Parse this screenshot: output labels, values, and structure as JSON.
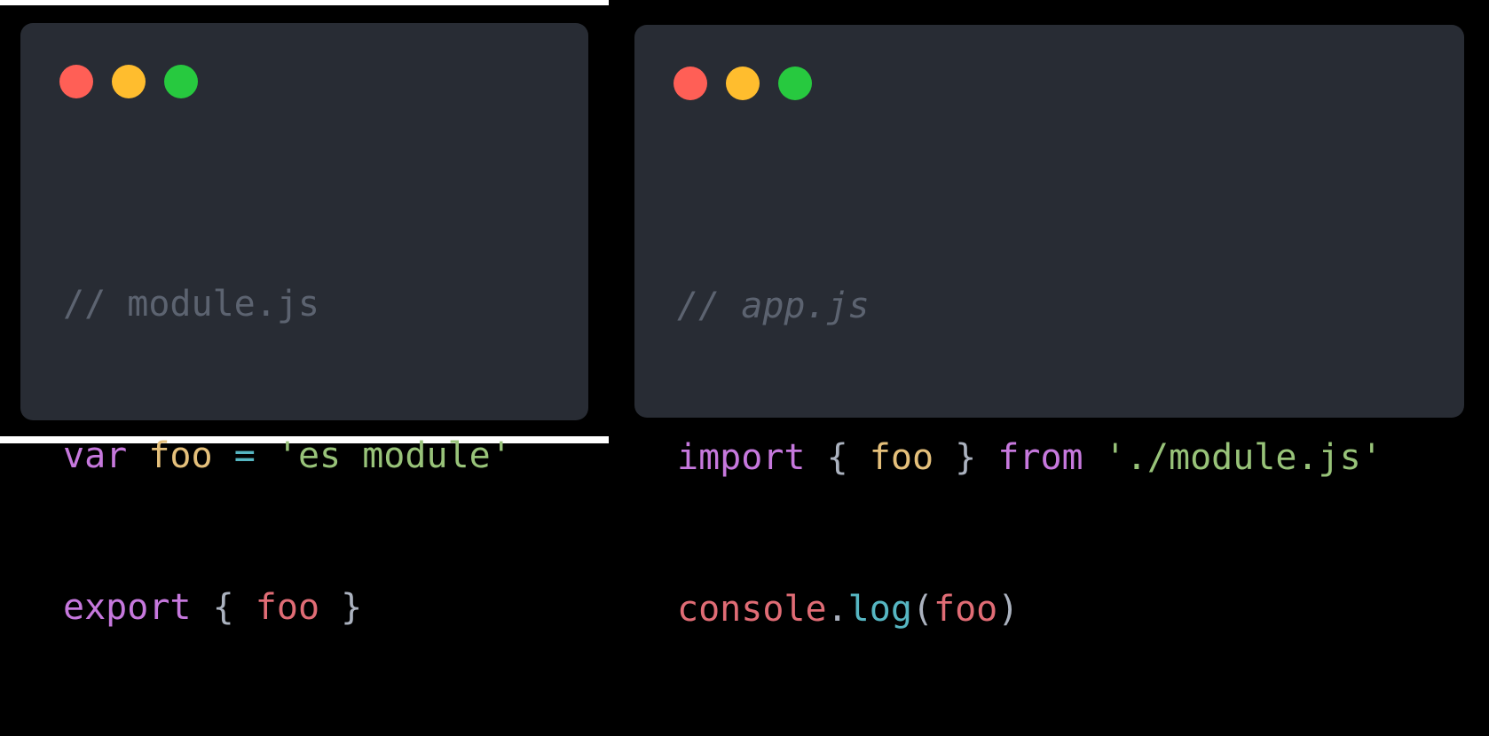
{
  "colors": {
    "background": "#000000",
    "window_bg": "#282c34",
    "dot_red": "#ff5f56",
    "dot_yellow": "#ffbd2e",
    "dot_green": "#27c93f",
    "comment": "#5c6370",
    "keyword": "#c678dd",
    "definition": "#e5c07b",
    "operator": "#56b6c2",
    "string": "#98c379",
    "variable": "#e06c75",
    "punctuation": "#abb2bf"
  },
  "left_window": {
    "comment": "// module.js",
    "line1": {
      "kw": "var",
      "name": "foo",
      "op": "=",
      "str": "'es module'"
    },
    "line2": {
      "kw": "export",
      "open": "{",
      "name": "foo",
      "close": "}"
    }
  },
  "right_window": {
    "comment": "// app.js",
    "line1": {
      "kw": "import",
      "open": "{",
      "name": "foo",
      "close": "}",
      "from": "from",
      "str": "'./module.js'"
    },
    "line2": {
      "obj": "console",
      "dot": ".",
      "fn": "log",
      "lparen": "(",
      "arg": "foo",
      "rparen": ")"
    }
  }
}
